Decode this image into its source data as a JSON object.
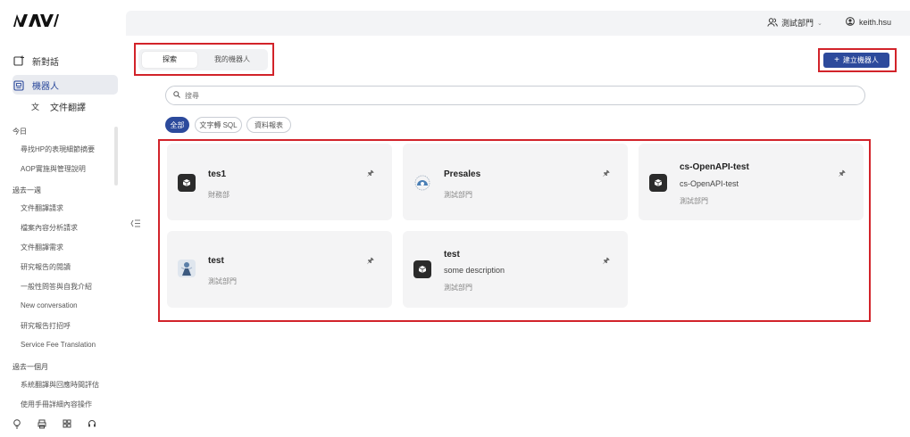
{
  "brand": {
    "logo_text": "NAVI",
    "accent": "#2c4a9c",
    "highlight": "#d2232a"
  },
  "sidebar": {
    "new_chat": "新對話",
    "bots": "機器人",
    "doc_translate": "文件翻譯",
    "sections": [
      {
        "title": "今日",
        "items": [
          "尋找HP的表現細節摘要",
          "AOP實施與管理說明"
        ]
      },
      {
        "title": "過去一週",
        "items": [
          "文件翻譯請求",
          "檔案內容分析請求",
          "文件翻譯需求",
          "研究報告的閱讀",
          "一般性問答與自我介紹",
          "New conversation",
          "研究報告打招呼",
          "Service Fee Translation"
        ]
      },
      {
        "title": "過去一個月",
        "items": [
          "系統翻譯與回應時間評估",
          "使用手冊詳細內容操作"
        ]
      }
    ],
    "bottom_icons": [
      "lightbulb-icon",
      "printer-icon",
      "grid-icon",
      "headset-icon"
    ]
  },
  "topbar": {
    "org_name": "測試部門",
    "user_name": "keith.hsu"
  },
  "tabs": {
    "all": "探索",
    "mine": "我的機器人"
  },
  "create_button": "建立機器人",
  "search": {
    "placeholder": "搜尋"
  },
  "filters": [
    "全部",
    "文字轉 SQL",
    "資料報表"
  ],
  "cards": [
    {
      "name": "tes1",
      "description": "",
      "org": "財務部",
      "avatar": "cube-icon"
    },
    {
      "name": "Presales",
      "description": "",
      "org": "測試部門",
      "avatar": "presales-logo"
    },
    {
      "name": "cs-OpenAPI-test",
      "description": "cs-OpenAPI-test",
      "org": "測試部門",
      "avatar": "cube-icon"
    },
    {
      "name": "test",
      "description": "",
      "org": "測試部門",
      "avatar": "character-image"
    },
    {
      "name": "test",
      "description": "some description",
      "org": "測試部門",
      "avatar": "cube-icon"
    }
  ]
}
